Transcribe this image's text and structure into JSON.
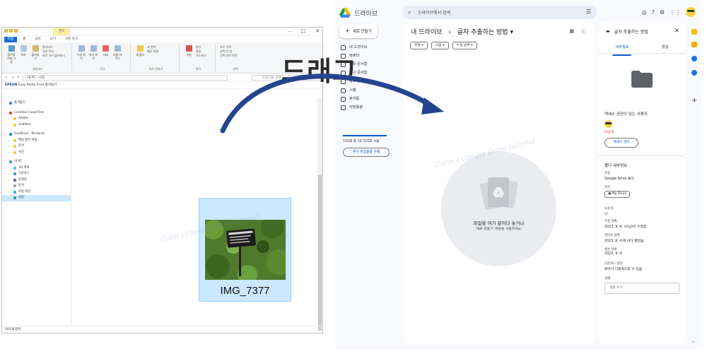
{
  "explorer": {
    "context_tab": "관리",
    "tabs": [
      "파일",
      "홈",
      "공유",
      "보기",
      "사진 도구"
    ],
    "ribbon": {
      "pin_label": "즐겨찾기에 고정",
      "copy_label": "복사",
      "paste_label": "붙여넣기",
      "clipboard_small": [
        "잘라내기",
        "경로 복사",
        "바로 가기 붙여넣기"
      ],
      "clipboard_group": "클립보드",
      "move_label": "이동 위치",
      "copyto_label": "복사 위치",
      "delete_label": "삭제",
      "rename_label": "이름 바꾸기",
      "organize_group": "구성",
      "newfolder_label": "새 폴더",
      "new_small": [
        "새 항목",
        "빠른 연결"
      ],
      "new_group": "새로 만들기",
      "properties_label": "속성",
      "open_small": [
        "열기",
        "편집",
        "히스토리"
      ],
      "open_group": "열기",
      "select_small": [
        "모두 선택",
        "선택 안 함",
        "선택 영역 반전"
      ],
      "select_group": "선택"
    },
    "address_path": "› 내 PC › 사진",
    "search_placeholder": "230728 검색",
    "favorites_bar": "Easy Photo Print",
    "favorites_brand": "EPSON",
    "favorites_extra": "즐겨찾기",
    "tree": [
      {
        "label": "즐겨찾기",
        "icon_color": "#3b82f6"
      },
      {
        "label": "Creative Cloud Files",
        "icon_color": "#e8453c"
      },
      {
        "label": "Adobe",
        "icon_color": "#f2c94c"
      },
      {
        "label": "Audition",
        "icon_color": "#f2c94c"
      },
      {
        "label": "OneDrive - Personal",
        "icon_color": "#1e88e5"
      },
      {
        "label": "메일 첨부 파일",
        "icon_color": "#f2c94c"
      },
      {
        "label": "문서",
        "icon_color": "#f2c94c"
      },
      {
        "label": "사진",
        "icon_color": "#f2c94c"
      },
      {
        "label": "내 PC",
        "icon_color": "#4a90d9"
      },
      {
        "label": "3D 개체",
        "icon_color": "#4fc3f7"
      },
      {
        "label": "다운로드",
        "icon_color": "#4a90d9"
      },
      {
        "label": "동영상",
        "icon_color": "#7e57c2"
      },
      {
        "label": "문서",
        "icon_color": "#90a4ae"
      },
      {
        "label": "바탕 화면",
        "icon_color": "#42a5f5"
      },
      {
        "label": "사진",
        "icon_color": "#26a69a"
      }
    ],
    "file_name": "IMG_7377",
    "status": "501개 항목"
  },
  "drag_label": "드래그",
  "watermark_text": "Colin's Google Drive tutorial",
  "drive": {
    "app_name": "드라이브",
    "search_placeholder": "드라이브에서 검색",
    "new_button": "새로 만들기",
    "nav": [
      "내 드라이브",
      "컴퓨터",
      "공유 문서함",
      "최근 문서함",
      "중요 문서함",
      "스팸",
      "휴지통",
      "저장용량"
    ],
    "storage_used_fraction": 1.0,
    "storage_text": "15GB 중 10.31GB 사용",
    "buy_storage": "추가 저장용량 구매",
    "breadcrumb_root": "내 드라이브",
    "breadcrumb_sep": "›",
    "breadcrumb_current": "글자 추출하는 방법",
    "filters": [
      "유형",
      "사람",
      "수정 날짜"
    ],
    "drop_title": "파일을 여기 끌어다 놓거나",
    "drop_subtitle": "'새로 만들기' 버튼을 사용하세요.",
    "panel": {
      "title": "글자 추출하는 방법",
      "tabs": [
        "세부정보",
        "활동"
      ],
      "access_title": "액세스 권한이 있는 사용자",
      "private_label": "비공개",
      "manage_access": "액세스 관리",
      "folder_props_title": "폴더 세부정보",
      "details": [
        {
          "label": "유형",
          "value": "Google Drive 폴더"
        },
        {
          "label": "위치",
          "value": "My Drive"
        },
        {
          "label": "소유자",
          "value": "나"
        },
        {
          "label": "수정 날짜",
          "value": "2023. 9. 4. 나(님)이 수정함"
        },
        {
          "label": "열어본 날짜",
          "value": "2023. 9. 4.에 내가 열었음"
        },
        {
          "label": "생성 날짜",
          "value": "2023. 9. 4."
        },
        {
          "label": "다운로드 권한",
          "value": "뷰어가 다운로드할 수 있음"
        }
      ],
      "description_label": "설명",
      "description_placeholder": "설명 추가"
    }
  },
  "colors": {
    "drive_blue": "#0b57d0",
    "explorer_selection": "#cce8ff",
    "arrow": "#23458f"
  }
}
